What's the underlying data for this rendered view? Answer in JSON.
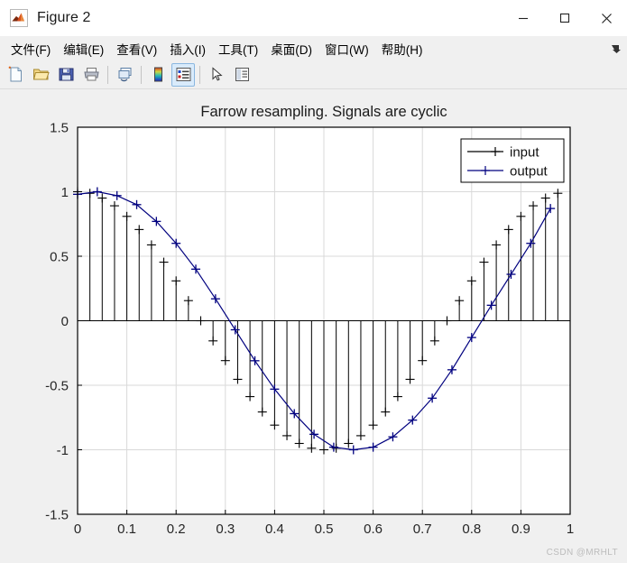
{
  "window": {
    "title": "Figure 2",
    "app_icon": "matlab-logo-icon",
    "controls": [
      {
        "name": "minimize-button",
        "glyph": "minimize-icon"
      },
      {
        "name": "maximize-button",
        "glyph": "maximize-icon"
      },
      {
        "name": "close-button",
        "glyph": "close-icon"
      }
    ]
  },
  "menubar": {
    "items": [
      {
        "label": "文件(F)",
        "name": "menu-file"
      },
      {
        "label": "编辑(E)",
        "name": "menu-edit"
      },
      {
        "label": "查看(V)",
        "name": "menu-view"
      },
      {
        "label": "插入(I)",
        "name": "menu-insert"
      },
      {
        "label": "工具(T)",
        "name": "menu-tools"
      },
      {
        "label": "桌面(D)",
        "name": "menu-desktop"
      },
      {
        "label": "窗口(W)",
        "name": "menu-window"
      },
      {
        "label": "帮助(H)",
        "name": "menu-help"
      }
    ],
    "overflow_icon": "menu-overflow-icon"
  },
  "toolbar": {
    "buttons": [
      {
        "name": "new-figure-button",
        "icon": "new-document-icon",
        "active": false
      },
      {
        "name": "open-file-button",
        "icon": "open-folder-icon",
        "active": false
      },
      {
        "name": "save-figure-button",
        "icon": "floppy-save-icon",
        "active": false
      },
      {
        "name": "print-figure-button",
        "icon": "printer-icon",
        "active": false
      },
      {
        "name": "separator-1",
        "icon": "separator",
        "active": false
      },
      {
        "name": "link-plot-button",
        "icon": "link-plot-icon",
        "active": false
      },
      {
        "name": "separator-2",
        "icon": "separator",
        "active": false
      },
      {
        "name": "insert-colorbar-button",
        "icon": "colorbar-icon",
        "active": false
      },
      {
        "name": "insert-legend-button",
        "icon": "legend-icon",
        "active": true
      },
      {
        "name": "separator-3",
        "icon": "separator",
        "active": false
      },
      {
        "name": "edit-plot-button",
        "icon": "arrow-pointer-icon",
        "active": false
      },
      {
        "name": "property-inspector-button",
        "icon": "property-inspector-icon",
        "active": false
      }
    ]
  },
  "figure": {
    "watermark": "CSDN @MRHLT"
  },
  "chart_data": {
    "type": "line",
    "title": "Farrow resampling. Signals are cyclic",
    "xlabel": "",
    "ylabel": "",
    "xlim": [
      0,
      1
    ],
    "ylim": [
      -1.5,
      1.5
    ],
    "xticks": [
      0,
      0.1,
      0.2,
      0.3,
      0.4,
      0.5,
      0.6,
      0.7,
      0.8,
      0.9,
      1
    ],
    "xticklabels": [
      "0",
      "0.1",
      "0.2",
      "0.3",
      "0.4",
      "0.5",
      "0.6",
      "0.7",
      "0.8",
      "0.9",
      "1"
    ],
    "yticks": [
      -1.5,
      -1,
      -0.5,
      0,
      0.5,
      1,
      1.5
    ],
    "yticklabels": [
      "-1.5",
      "-1",
      "-0.5",
      "0",
      "0.5",
      "1",
      "1.5"
    ],
    "grid": true,
    "legend": {
      "position": "top-right",
      "entries": [
        "input",
        "output"
      ]
    },
    "colors": {
      "input": "#000000",
      "output": "#00007f",
      "grid": "#d9d9d9",
      "axis": "#000000",
      "background": "#ffffff",
      "figure_background": "#f0f0f0"
    },
    "series": [
      {
        "name": "input",
        "style": "stem",
        "marker": "+",
        "color": "#000000",
        "x": [
          0.0,
          0.025,
          0.05,
          0.075,
          0.1,
          0.125,
          0.15,
          0.175,
          0.2,
          0.225,
          0.25,
          0.275,
          0.3,
          0.325,
          0.35,
          0.375,
          0.4,
          0.425,
          0.45,
          0.475,
          0.5,
          0.525,
          0.55,
          0.575,
          0.6,
          0.625,
          0.65,
          0.675,
          0.7,
          0.725,
          0.75,
          0.775,
          0.8,
          0.825,
          0.85,
          0.875,
          0.9,
          0.925,
          0.95,
          0.975
        ],
        "y": [
          1.0,
          0.988,
          0.951,
          0.891,
          0.809,
          0.707,
          0.588,
          0.454,
          0.309,
          0.156,
          0.0,
          -0.156,
          -0.309,
          -0.454,
          -0.588,
          -0.707,
          -0.809,
          -0.891,
          -0.951,
          -0.988,
          -1.0,
          -0.988,
          -0.951,
          -0.891,
          -0.809,
          -0.707,
          -0.588,
          -0.454,
          -0.309,
          -0.156,
          0.0,
          0.156,
          0.309,
          0.454,
          0.588,
          0.707,
          0.809,
          0.891,
          0.951,
          0.988
        ]
      },
      {
        "name": "output",
        "style": "line-marker",
        "marker": "+",
        "color": "#00007f",
        "x": [
          0.0,
          0.04,
          0.08,
          0.12,
          0.16,
          0.2,
          0.24,
          0.28,
          0.32,
          0.36,
          0.4,
          0.44,
          0.48,
          0.52,
          0.56,
          0.6,
          0.64,
          0.68,
          0.72,
          0.76,
          0.8,
          0.84,
          0.88,
          0.92,
          0.96
        ],
        "y": [
          0.98,
          1.0,
          0.97,
          0.9,
          0.77,
          0.6,
          0.4,
          0.17,
          -0.07,
          -0.31,
          -0.53,
          -0.72,
          -0.88,
          -0.98,
          -1.0,
          -0.98,
          -0.9,
          -0.77,
          -0.6,
          -0.38,
          -0.13,
          0.12,
          0.36,
          0.6,
          0.87
        ]
      }
    ]
  }
}
